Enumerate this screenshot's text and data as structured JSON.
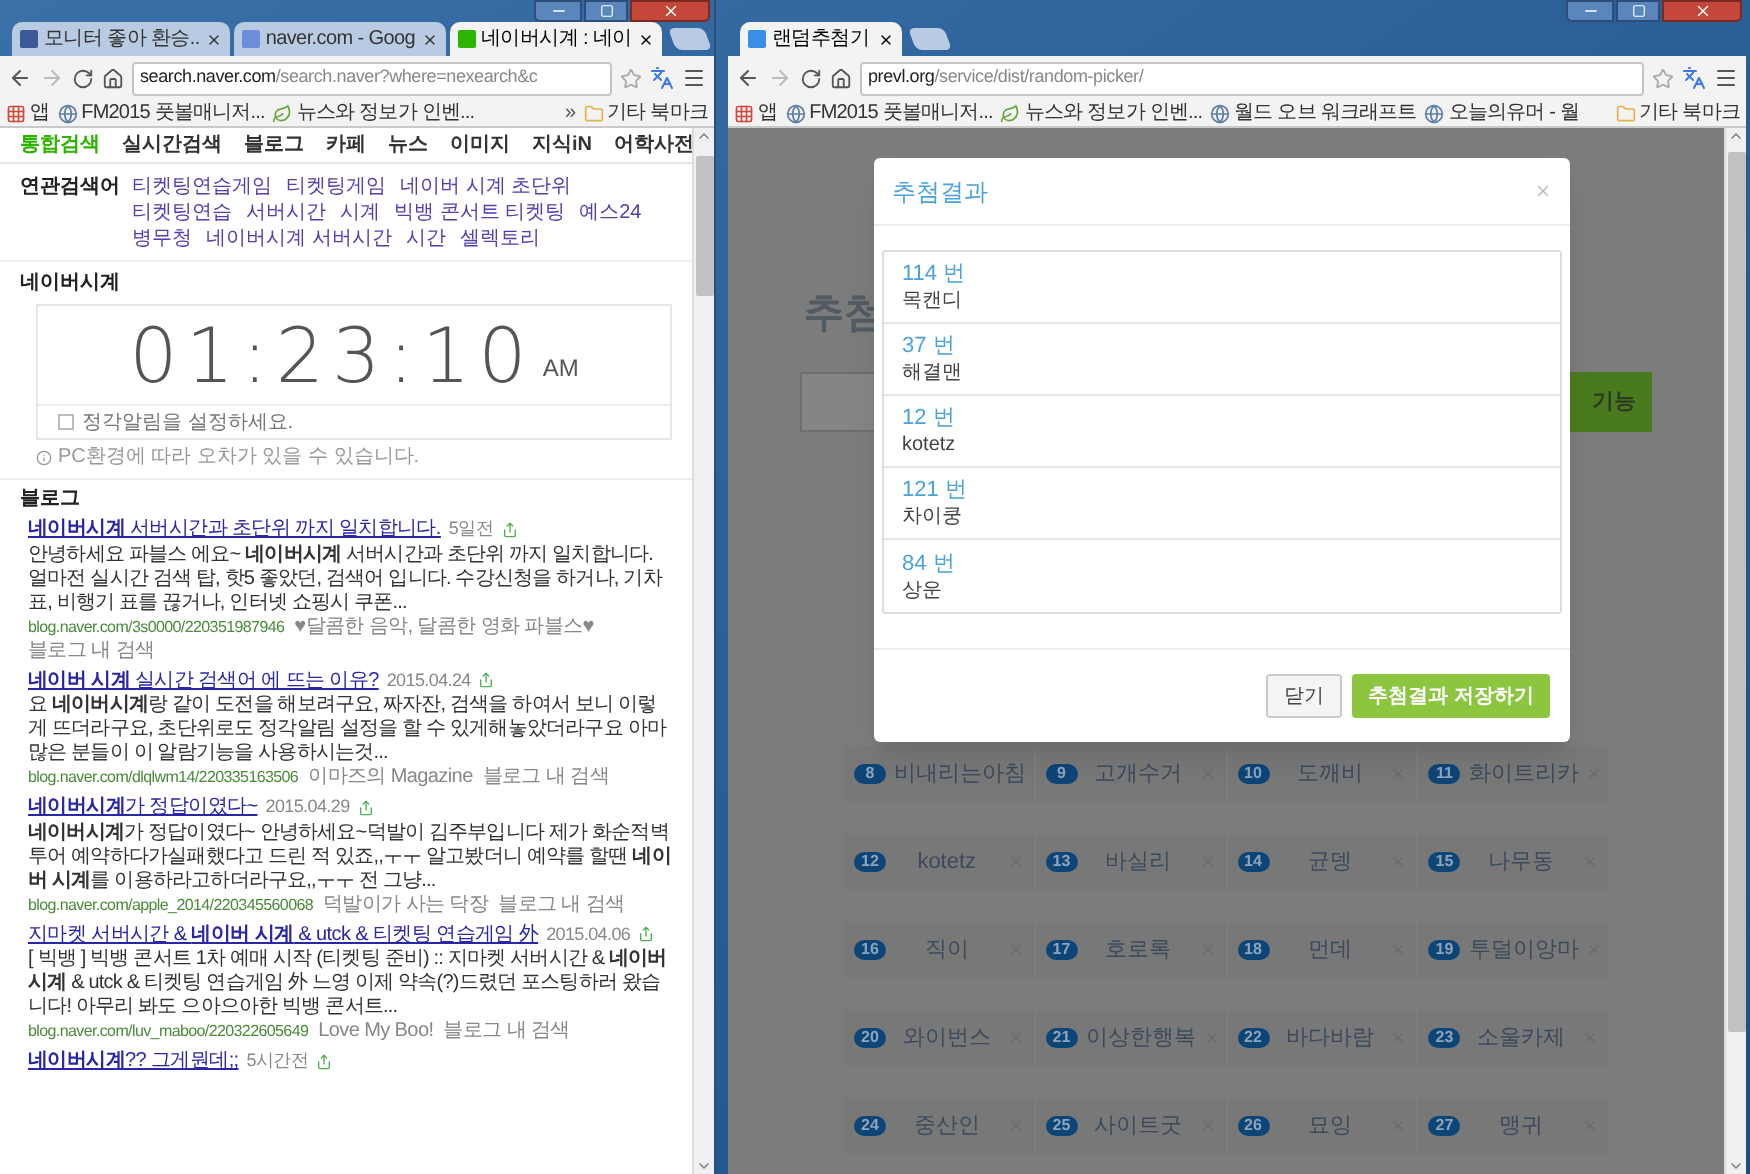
{
  "left_window": {
    "tabs": [
      {
        "title": "모니터 좋아 환승..",
        "selected": false,
        "color": "#3b5998"
      },
      {
        "title": "naver.com - Goog",
        "selected": false,
        "color": "#6a8fd8"
      },
      {
        "title": "네이버시계 : 네이",
        "selected": true,
        "color": "#2db400"
      }
    ],
    "address": {
      "host": "search.naver.com",
      "path": "/search.naver?where=nexearch&c"
    },
    "bookmarks": [
      {
        "kind": "apps",
        "label": "앱"
      },
      {
        "kind": "site",
        "label": "FM2015 풋볼매니저..."
      },
      {
        "kind": "leaf",
        "label": "뉴스와 정보가 인벤..."
      }
    ],
    "overflow": "»",
    "other_bookmarks": "기타 북마크",
    "page": {
      "nav": [
        {
          "label": "통합검색",
          "selected": true
        },
        {
          "label": "실시간검색",
          "selected": false
        },
        {
          "label": "블로그",
          "selected": false
        },
        {
          "label": "카페",
          "selected": false
        },
        {
          "label": "뉴스",
          "selected": false
        },
        {
          "label": "이미지",
          "selected": false
        },
        {
          "label": "지식iN",
          "selected": false
        },
        {
          "label": "어학사전",
          "selected": false
        }
      ],
      "related": {
        "label": "연관검색어",
        "items": [
          "티켓팅연습게임",
          "티켓팅게임",
          "네이버 시계 초단위",
          "티켓팅연습",
          "서버시간",
          "시계",
          "빅뱅 콘서트 티켓팅",
          "예스24",
          "병무청",
          "네이버시계 서버시간",
          "시간",
          "셀렉토리"
        ]
      },
      "clock": {
        "heading": "네이버시계",
        "time": "01:23:10",
        "period": "AM",
        "alarm": {
          "label": "정각알림을 설정하세요.",
          "checked": false
        },
        "note": "PC환경에 따라 오차가 있을 수 있습니다."
      },
      "blog": {
        "heading": "블로그",
        "results": [
          {
            "title": "**네이버시계** 서버시간과 초단위 까지 일치합니다.",
            "date": "5일전",
            "snippet": "안녕하세요 파블스 에요~ **네이버시계** 서버시간과 초단위 까지 일치합니다. 얼마전 실시간 검색 탑, 핫5 좋았던, 검색어 입니다. 수강신청을 하거나, 기차표, 비행기 표를 끊거나, 인터넷 쇼핑시 쿠폰...",
            "url": "blog.naver.com/3s0000/220351987946",
            "source": "♥달콤한 음악, 달콤한 영화 파블스♥",
            "search_link": "블로그 내 검색"
          },
          {
            "title": "**네이버 시계** 실시간 검색어 에 뜨는 이유?",
            "date": "2015.04.24",
            "snippet": "요 **네이버시계**랑 같이 도전을 해보려구요, 짜자잔, 검색을 하여서 보니 이렇게 뜨더라구요, 초단위로도 정각알림 설정을 할 수 있게해놓았더라구요 아마 많은 분들이 이 알람기능을 사용하시는것...",
            "url": "blog.naver.com/dlqlwm14/220335163506",
            "source": "이마즈의 Magazine",
            "search_link": "블로그 내 검색"
          },
          {
            "title": "**네이버시계**가 정답이였다~",
            "date": "2015.04.29",
            "snippet": "**네이버시계**가 정답이였다~ 안녕하세요~덕발이 김주부입니다 제가 화순적벽투어 예약하다가실패했다고 드린 적 있죠,,ㅜㅜ 알고봤더니 예약를 할땐 **네이버 시계**를 이용하라고하더라구요,,ㅜㅜ 전 그냥...",
            "url": "blog.naver.com/apple_2014/220345560068",
            "source": "덕발이가 사는 닥장",
            "search_link": "블로그 내 검색"
          },
          {
            "title": "지마켓 서버시간 & **네이버 시계** & utck & 티켓팅 연습게임 外",
            "date": "2015.04.06",
            "snippet": "[ 빅뱅 ] 빅뱅 콘서트 1차 예매 시작 (티켓팅 준비) :: 지마켓 서버시간 & **네이버 시계** & utck & 티켓팅 연습게임 外 느영 이제 약속(?)드렸던 포스팅하러 왔습니다! 아무리 봐도 으아으아한 빅뱅 콘서트...",
            "url": "blog.naver.com/luv_maboo/220322605649",
            "source": "Love My Boo!",
            "search_link": "블로그 내 검색"
          },
          {
            "title": "**네이버시계**?? 그게뭔데;;",
            "date": "5시간전"
          }
        ]
      }
    }
  },
  "right_window": {
    "tabs": [
      {
        "title": "랜덤추첨기",
        "selected": true,
        "color": "#3a8ee6"
      }
    ],
    "address": {
      "host": "prevl.org",
      "path": "/service/dist/random-picker/"
    },
    "bookmarks": [
      {
        "kind": "apps",
        "label": "앱"
      },
      {
        "kind": "site",
        "label": "FM2015 풋볼매니저..."
      },
      {
        "kind": "leaf",
        "label": "뉴스와 정보가 인벤..."
      },
      {
        "kind": "site",
        "label": "월드 오브 워크래프트"
      },
      {
        "kind": "site",
        "label": "오늘의유머 - 월"
      }
    ],
    "other_bookmarks": "기타 북마크",
    "page": {
      "heading": "추첨",
      "action_button": "기능",
      "participants": [
        {
          "number": "8",
          "name": "비내리는아침"
        },
        {
          "number": "9",
          "name": "고개수거"
        },
        {
          "number": "10",
          "name": "도깨비"
        },
        {
          "number": "11",
          "name": "화이트리카"
        },
        {
          "number": "12",
          "name": "kotetz"
        },
        {
          "number": "13",
          "name": "바실리"
        },
        {
          "number": "14",
          "name": "균뎅"
        },
        {
          "number": "15",
          "name": "나무동"
        },
        {
          "number": "16",
          "name": "직이"
        },
        {
          "number": "17",
          "name": "호로록"
        },
        {
          "number": "18",
          "name": "먼데"
        },
        {
          "number": "19",
          "name": "투덜이앙마"
        },
        {
          "number": "20",
          "name": "와이번스"
        },
        {
          "number": "21",
          "name": "이상한행복"
        },
        {
          "number": "22",
          "name": "바다바람"
        },
        {
          "number": "23",
          "name": "소울카제"
        },
        {
          "number": "24",
          "name": "중산인"
        },
        {
          "number": "25",
          "name": "사이트굿"
        },
        {
          "number": "26",
          "name": "묘잉"
        },
        {
          "number": "27",
          "name": "맹귀"
        }
      ],
      "modal": {
        "title": "추첨결과",
        "results": [
          {
            "number": "114 번",
            "name": "목캔디"
          },
          {
            "number": "37 번",
            "name": "해결맨"
          },
          {
            "number": "12 번",
            "name": "kotetz"
          },
          {
            "number": "121 번",
            "name": "차이쿵"
          },
          {
            "number": "84 번",
            "name": "상운"
          }
        ],
        "buttons": [
          {
            "kind": "default",
            "label": "닫기"
          },
          {
            "kind": "primary",
            "label": "추첨결과 저장하기"
          }
        ]
      }
    }
  }
}
